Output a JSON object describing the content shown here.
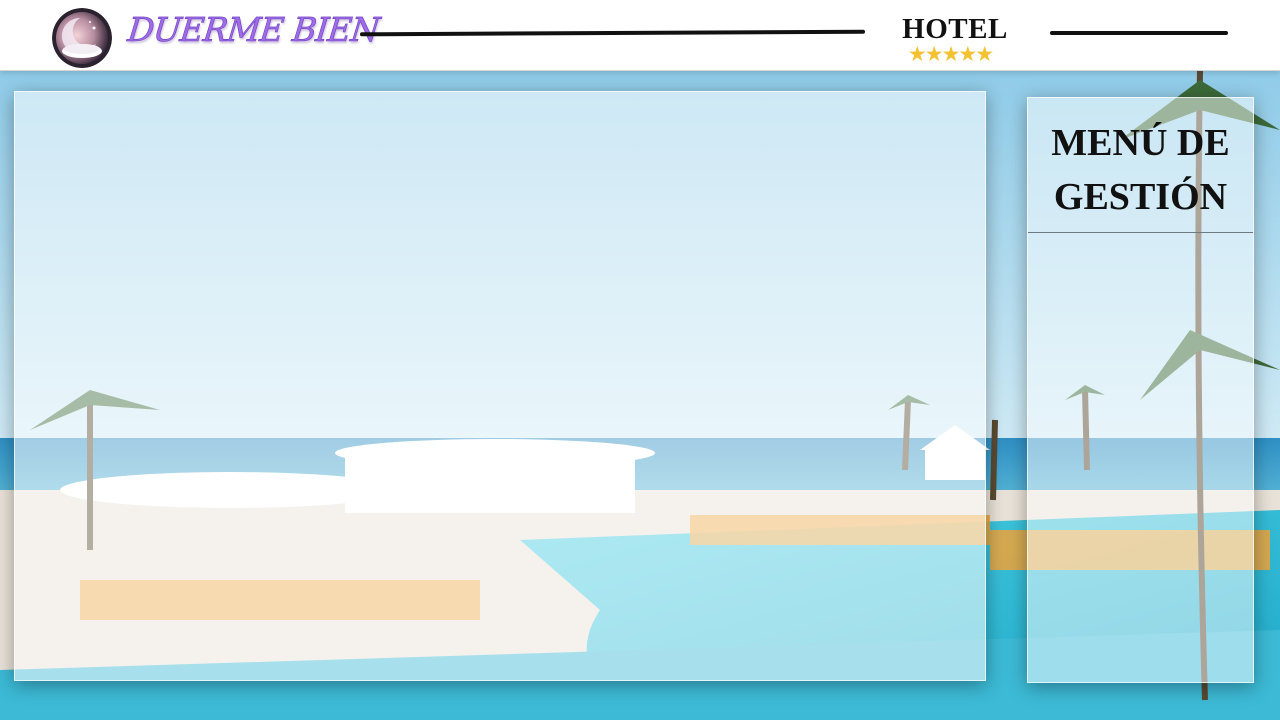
{
  "header": {
    "brand_name": "DUERME BIEN",
    "hotel_label": "HOTEL",
    "star_rating": 5,
    "stars_text": "★★★★★"
  },
  "side_panel": {
    "title_line1": "MENÚ DE",
    "title_line2": "GESTIÓN"
  },
  "colors": {
    "brand": "#a06be6",
    "stars": "#f2c232",
    "pool": "#3fc3d8",
    "sky": "#bfe3f2"
  },
  "icons": {
    "logo": "moon-pillow-logo-icon"
  }
}
